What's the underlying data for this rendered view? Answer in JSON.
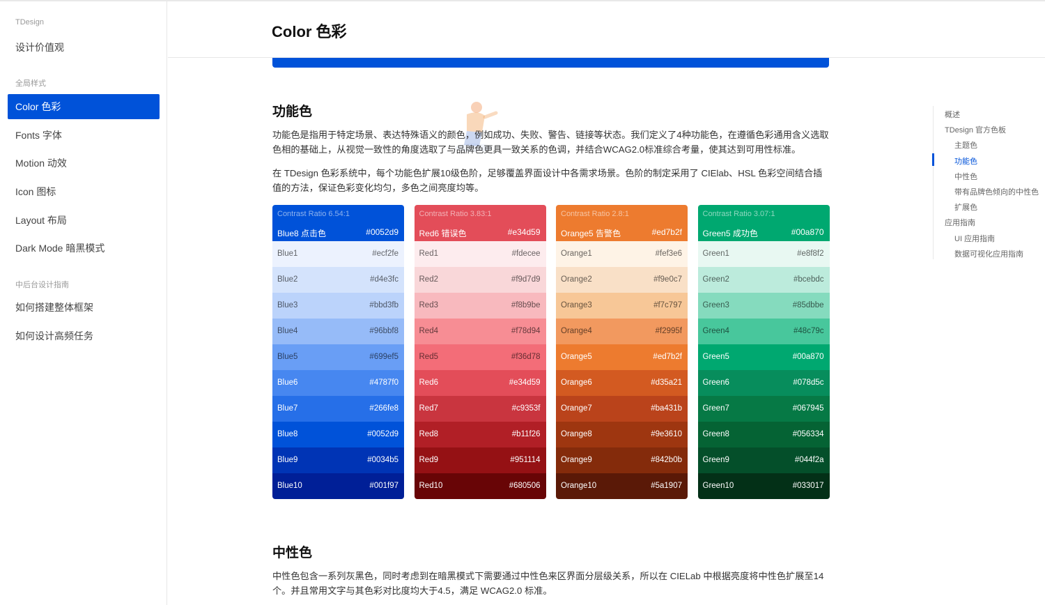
{
  "sidebar": {
    "brand": "TDesign",
    "top_item": "设计价值观",
    "group1": "全局样式",
    "items": [
      "Color 色彩",
      "Fonts 字体",
      "Motion 动效",
      "Icon 图标",
      "Layout 布局",
      "Dark Mode 暗黑模式"
    ],
    "group2": "中后台设计指南",
    "items2": [
      "如何搭建整体框架",
      "如何设计高频任务"
    ]
  },
  "header": {
    "title": "Color 色彩"
  },
  "section1": {
    "title": "功能色",
    "p1": "功能色是指用于特定场景、表达特殊语义的颜色，例如成功、失败、警告、链接等状态。我们定义了4种功能色，在遵循色彩通用含义选取色相的基础上，从视觉一致性的角度选取了与品牌色更具一致关系的色调，并结合WCAG2.0标准综合考量，使其达到可用性标准。",
    "p2": "在 TDesign 色彩系统中，每个功能色扩展10级色阶，足够覆盖界面设计中各需求场景。色阶的制定采用了 CIElab、HSL 色彩空间结合插值的方法，保证色彩变化均匀，多色之间亮度均等。"
  },
  "palettes": [
    {
      "ratio": "Contrast Ratio 6.54:1",
      "head_name": "Blue8 点击色",
      "head_hex": "#0052d9",
      "swatches": [
        {
          "name": "Blue1",
          "hex": "#ecf2fe"
        },
        {
          "name": "Blue2",
          "hex": "#d4e3fc"
        },
        {
          "name": "Blue3",
          "hex": "#bbd3fb"
        },
        {
          "name": "Blue4",
          "hex": "#96bbf8"
        },
        {
          "name": "Blue5",
          "hex": "#699ef5"
        },
        {
          "name": "Blue6",
          "hex": "#4787f0"
        },
        {
          "name": "Blue7",
          "hex": "#266fe8"
        },
        {
          "name": "Blue8",
          "hex": "#0052d9"
        },
        {
          "name": "Blue9",
          "hex": "#0034b5"
        },
        {
          "name": "Blue10",
          "hex": "#001f97"
        }
      ]
    },
    {
      "ratio": "Contrast Ratio 3.83:1",
      "head_name": "Red6 错误色",
      "head_hex": "#e34d59",
      "swatches": [
        {
          "name": "Red1",
          "hex": "#fdecee"
        },
        {
          "name": "Red2",
          "hex": "#f9d7d9"
        },
        {
          "name": "Red3",
          "hex": "#f8b9be"
        },
        {
          "name": "Red4",
          "hex": "#f78d94"
        },
        {
          "name": "Red5",
          "hex": "#f36d78"
        },
        {
          "name": "Red6",
          "hex": "#e34d59"
        },
        {
          "name": "Red7",
          "hex": "#c9353f"
        },
        {
          "name": "Red8",
          "hex": "#b11f26"
        },
        {
          "name": "Red9",
          "hex": "#951114"
        },
        {
          "name": "Red10",
          "hex": "#680506"
        }
      ]
    },
    {
      "ratio": "Contrast Ratio 2.8:1",
      "head_name": "Orange5 告警色",
      "head_hex": "#ed7b2f",
      "swatches": [
        {
          "name": "Orange1",
          "hex": "#fef3e6"
        },
        {
          "name": "Orange2",
          "hex": "#f9e0c7"
        },
        {
          "name": "Orange3",
          "hex": "#f7c797"
        },
        {
          "name": "Orange4",
          "hex": "#f2995f"
        },
        {
          "name": "Orange5",
          "hex": "#ed7b2f"
        },
        {
          "name": "Orange6",
          "hex": "#d35a21"
        },
        {
          "name": "Orange7",
          "hex": "#ba431b"
        },
        {
          "name": "Orange8",
          "hex": "#9e3610"
        },
        {
          "name": "Orange9",
          "hex": "#842b0b"
        },
        {
          "name": "Orange10",
          "hex": "#5a1907"
        }
      ]
    },
    {
      "ratio": "Contrast Ratio 3.07:1",
      "head_name": "Green5 成功色",
      "head_hex": "#00a870",
      "swatches": [
        {
          "name": "Green1",
          "hex": "#e8f8f2"
        },
        {
          "name": "Green2",
          "hex": "#bcebdc"
        },
        {
          "name": "Green3",
          "hex": "#85dbbe"
        },
        {
          "name": "Green4",
          "hex": "#48c79c"
        },
        {
          "name": "Green5",
          "hex": "#00a870"
        },
        {
          "name": "Green6",
          "hex": "#078d5c"
        },
        {
          "name": "Green7",
          "hex": "#067945"
        },
        {
          "name": "Green8",
          "hex": "#056334"
        },
        {
          "name": "Green9",
          "hex": "#044f2a"
        },
        {
          "name": "Green10",
          "hex": "#033017"
        }
      ]
    }
  ],
  "section2": {
    "title": "中性色",
    "p1": "中性色包含一系列灰黑色，同时考虑到在暗黑模式下需要通过中性色来区界面分层级关系，所以在 CIELab 中根据亮度将中性色扩展至14个。并且常用文字与其色彩对比度均大于4.5，满足 WCAG2.0 标准。"
  },
  "toc": [
    {
      "label": "概述",
      "level": 1,
      "active": false
    },
    {
      "label": "TDesign 官方色板",
      "level": 1,
      "active": false
    },
    {
      "label": "主题色",
      "level": 2,
      "active": false
    },
    {
      "label": "功能色",
      "level": 2,
      "active": true
    },
    {
      "label": "中性色",
      "level": 2,
      "active": false
    },
    {
      "label": "带有品牌色倾向的中性色",
      "level": 2,
      "active": false
    },
    {
      "label": "扩展色",
      "level": 2,
      "active": false
    },
    {
      "label": "应用指南",
      "level": 1,
      "active": false
    },
    {
      "label": "UI 应用指南",
      "level": 2,
      "active": false
    },
    {
      "label": "数据可视化应用指南",
      "level": 2,
      "active": false
    }
  ],
  "colors": {
    "brand": "#0052d9",
    "border": "#e7e7e7"
  }
}
